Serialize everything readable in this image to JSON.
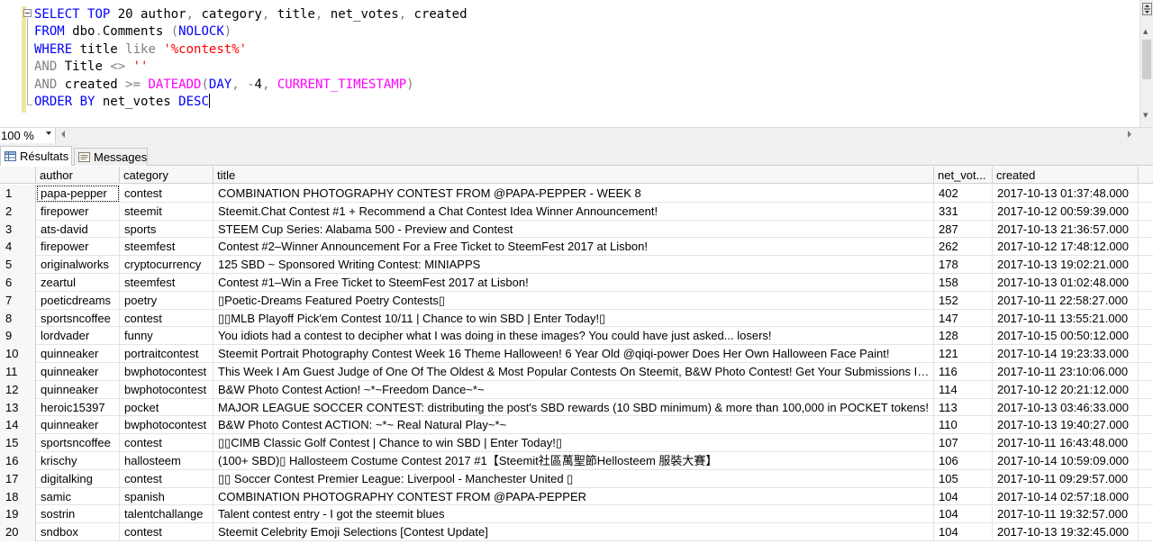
{
  "editor": {
    "lines": [
      {
        "tokens": [
          [
            "kw",
            "SELECT"
          ],
          [
            "",
            " "
          ],
          [
            "kw",
            "TOP"
          ],
          [
            "",
            " 20 author"
          ],
          [
            "gr",
            ","
          ],
          [
            "",
            " category"
          ],
          [
            "gr",
            ","
          ],
          [
            "",
            " title"
          ],
          [
            "gr",
            ","
          ],
          [
            "",
            " net_votes"
          ],
          [
            "gr",
            ","
          ],
          [
            "",
            " created"
          ]
        ]
      },
      {
        "tokens": [
          [
            "kw",
            "FROM"
          ],
          [
            "",
            " dbo"
          ],
          [
            "gr",
            "."
          ],
          [
            "",
            "Comments "
          ],
          [
            "gr",
            "("
          ],
          [
            "kw",
            "NOLOCK"
          ],
          [
            "gr",
            ")"
          ]
        ]
      },
      {
        "tokens": [
          [
            "kw",
            "WHERE"
          ],
          [
            "",
            " title "
          ],
          [
            "gr",
            "like"
          ],
          [
            "",
            " "
          ],
          [
            "str",
            "'%contest%'"
          ]
        ]
      },
      {
        "tokens": [
          [
            "gr",
            "AND"
          ],
          [
            "",
            " Title "
          ],
          [
            "gr",
            "<>"
          ],
          [
            "",
            " "
          ],
          [
            "str",
            "''"
          ]
        ]
      },
      {
        "tokens": [
          [
            "gr",
            "AND"
          ],
          [
            "",
            " created "
          ],
          [
            "gr",
            ">="
          ],
          [
            "",
            " "
          ],
          [
            "fn",
            "DATEADD"
          ],
          [
            "gr",
            "("
          ],
          [
            "kw",
            "DAY"
          ],
          [
            "gr",
            ","
          ],
          [
            "",
            " "
          ],
          [
            "gr",
            "-"
          ],
          [
            "",
            "4"
          ],
          [
            "gr",
            ","
          ],
          [
            "",
            " "
          ],
          [
            "fn",
            "CURRENT_TIMESTAMP"
          ],
          [
            "gr",
            ")"
          ]
        ]
      },
      {
        "tokens": [
          [
            "kw",
            "ORDER BY"
          ],
          [
            "",
            " net_votes "
          ],
          [
            "kw",
            "DESC"
          ]
        ]
      }
    ]
  },
  "zoom": {
    "value": "100 %"
  },
  "tabs": {
    "results": "Résultats",
    "messages": "Messages"
  },
  "grid": {
    "columns": [
      "author",
      "category",
      "title",
      "net_vot...",
      "created"
    ],
    "rows": [
      [
        "1",
        "papa-pepper",
        "contest",
        "COMBINATION PHOTOGRAPHY CONTEST FROM @PAPA-PEPPER - WEEK 8",
        "402",
        "2017-10-13 01:37:48.000"
      ],
      [
        "2",
        "firepower",
        "steemit",
        "Steemit.Chat Contest #1 + Recommend a Chat Contest Idea Winner Announcement!",
        "331",
        "2017-10-12 00:59:39.000"
      ],
      [
        "3",
        "ats-david",
        "sports",
        "STEEM Cup Series: Alabama 500 - Preview and Contest",
        "287",
        "2017-10-13 21:36:57.000"
      ],
      [
        "4",
        "firepower",
        "steemfest",
        "Contest #2–Winner Announcement For a Free Ticket to SteemFest 2017 at Lisbon!",
        "262",
        "2017-10-12 17:48:12.000"
      ],
      [
        "5",
        "originalworks",
        "cryptocurrency",
        "125 SBD ~ Sponsored Writing Contest: MINIAPPS",
        "178",
        "2017-10-13 19:02:21.000"
      ],
      [
        "6",
        "zeartul",
        "steemfest",
        "Contest #1–Win a Free Ticket to SteemFest 2017 at Lisbon!",
        "158",
        "2017-10-13 01:02:48.000"
      ],
      [
        "7",
        "poeticdreams",
        "poetry",
        "▯Poetic-Dreams Featured Poetry Contests▯",
        "152",
        "2017-10-11 22:58:27.000"
      ],
      [
        "8",
        "sportsncoffee",
        "contest",
        "▯▯MLB Playoff Pick'em Contest 10/11 | Chance to win SBD | Enter Today!▯",
        "147",
        "2017-10-11 13:55:21.000"
      ],
      [
        "9",
        "lordvader",
        "funny",
        "You idiots had a contest to decipher what I was doing in these images? You could have just asked... losers!",
        "128",
        "2017-10-15 00:50:12.000"
      ],
      [
        "10",
        "quinneaker",
        "portraitcontest",
        "Steemit Portrait Photography Contest Week 16 Theme Halloween! 6 Year Old @qiqi-power Does Her Own Halloween Face Paint!",
        "121",
        "2017-10-14 19:23:33.000"
      ],
      [
        "11",
        "quinneaker",
        "bwphotocontest",
        "This Week I Am Guest Judge of One Of The Oldest & Most Popular Contests On Steemit, B&W Photo Contest! Get Your Submissions In And Good Luck!",
        "116",
        "2017-10-11 23:10:06.000"
      ],
      [
        "12",
        "quinneaker",
        "bwphotocontest",
        "B&W Photo Contest Action!  ~*~Freedom Dance~*~",
        "114",
        "2017-10-12 20:21:12.000"
      ],
      [
        "13",
        "heroic15397",
        "pocket",
        "MAJOR LEAGUE SOCCER CONTEST: distributing the post's SBD rewards (10 SBD minimum) & more than 100,000 in POCKET tokens!",
        "113",
        "2017-10-13 03:46:33.000"
      ],
      [
        "14",
        "quinneaker",
        "bwphotocontest",
        "B&W Photo Contest ACTION: ~*~ Real Natural Play~*~",
        "110",
        "2017-10-13 19:40:27.000"
      ],
      [
        "15",
        "sportsncoffee",
        "contest",
        "▯▯CIMB Classic Golf Contest | Chance to win SBD | Enter Today!▯",
        "107",
        "2017-10-11 16:43:48.000"
      ],
      [
        "16",
        "krischy",
        "hallosteem",
        "(100+ SBD)▯ Hallosteem Costume Contest 2017 #1【Steemit社區萬聖節Hellosteem 服裝大賽】",
        "106",
        "2017-10-14 10:59:09.000"
      ],
      [
        "17",
        "digitalking",
        "contest",
        "▯▯ Soccer Contest Premier League: Liverpool - Manchester United ▯",
        "105",
        "2017-10-11 09:29:57.000"
      ],
      [
        "18",
        "samic",
        "spanish",
        "COMBINATION PHOTOGRAPHY CONTEST FROM @PAPA-PEPPER",
        "104",
        "2017-10-14 02:57:18.000"
      ],
      [
        "19",
        "sostrin",
        "talentchallange",
        "Talent contest entry - I got the steemit blues",
        "104",
        "2017-10-11 19:32:57.000"
      ],
      [
        "20",
        "sndbox",
        "contest",
        "Steemit Celebrity Emoji Selections [Contest Update]",
        "104",
        "2017-10-13 19:32:45.000"
      ]
    ]
  }
}
